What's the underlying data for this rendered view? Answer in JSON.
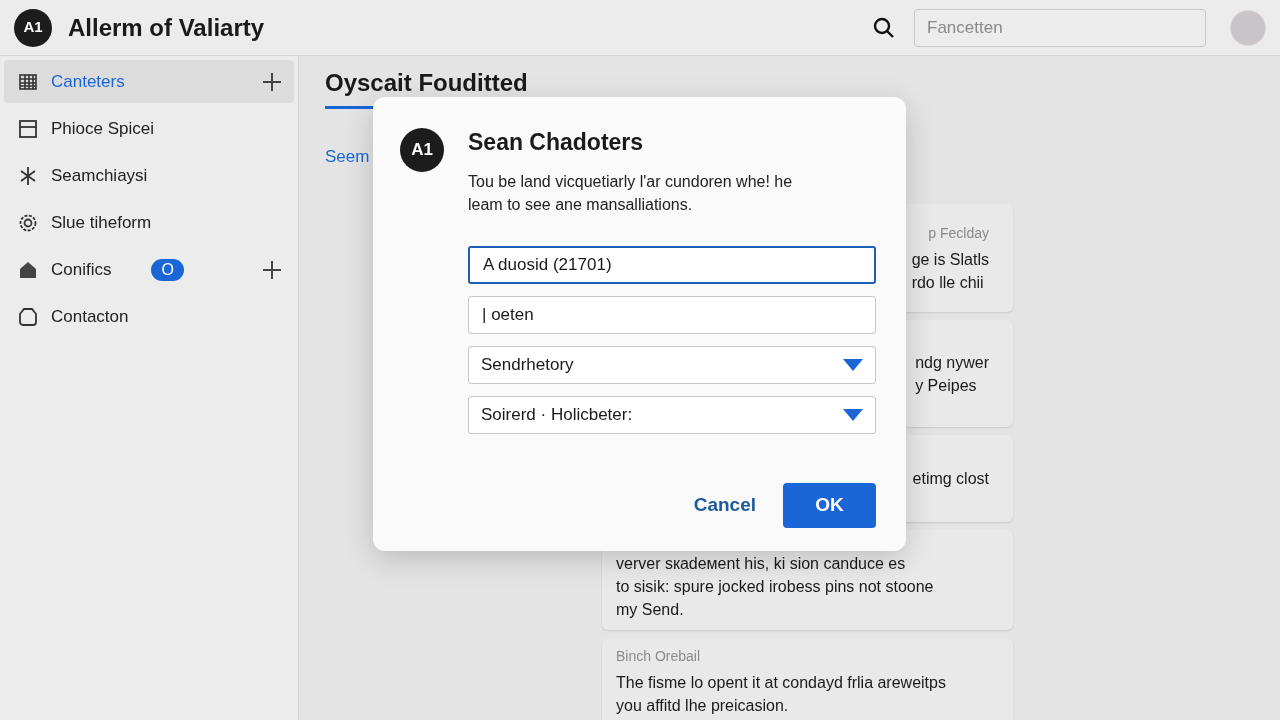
{
  "header": {
    "logo": "A1",
    "title": "Allerm of Valiarty",
    "search": {
      "placeholder": "Fancetten"
    }
  },
  "sidebar": {
    "items": [
      {
        "label": "Canteters",
        "selected": true,
        "add": true
      },
      {
        "label": "Phioce Spicei",
        "selected": false,
        "add": false
      },
      {
        "label": "Seamchiaysi",
        "selected": false,
        "add": false
      },
      {
        "label": "Slue tiheform",
        "selected": false,
        "add": false
      },
      {
        "label": "Conifics",
        "selected": false,
        "add": true,
        "badge": "O"
      },
      {
        "label": "Contacton",
        "selected": false,
        "add": false
      }
    ]
  },
  "main": {
    "title": "Oyscait Fouditted",
    "link": "Seem",
    "cards": [
      {
        "kind": "clipped",
        "label": "p Feclday",
        "text": "ge is Slatls\nrdo lle chii"
      },
      {
        "kind": "clipped",
        "text": "ndg nywer\ny Peipes"
      },
      {
        "kind": "clipped",
        "text": "etimg clost"
      },
      {
        "kind": "full",
        "text": "verver sкadeмent his, ki sion canduce es\nto sisik: spure jocked irobess pins not stoone\nmy Send."
      },
      {
        "kind": "full",
        "label": "Binch Orebail",
        "text": "The fisme lo opent it at condayd frlia areweitps\nyou affitd lhe preicasion."
      }
    ]
  },
  "dialog": {
    "badge": "A1",
    "title": "Sean Chadoters",
    "message": "Tou be land vicquetiarly l'ar cundoren whe! he\nleam to see ane mansalliations.",
    "fields": [
      {
        "kind": "input",
        "value": "A duosid (21701)",
        "focused": true
      },
      {
        "kind": "input",
        "value": "| oeten",
        "focused": false
      },
      {
        "kind": "select",
        "value": "Sendrhetory",
        "focused": false
      },
      {
        "kind": "select",
        "value": "Soirerd · Holicbeter:",
        "focused": false
      }
    ],
    "buttons": [
      {
        "kind": "text",
        "label": "Cancel"
      },
      {
        "kind": "primary",
        "label": "OK"
      }
    ]
  }
}
